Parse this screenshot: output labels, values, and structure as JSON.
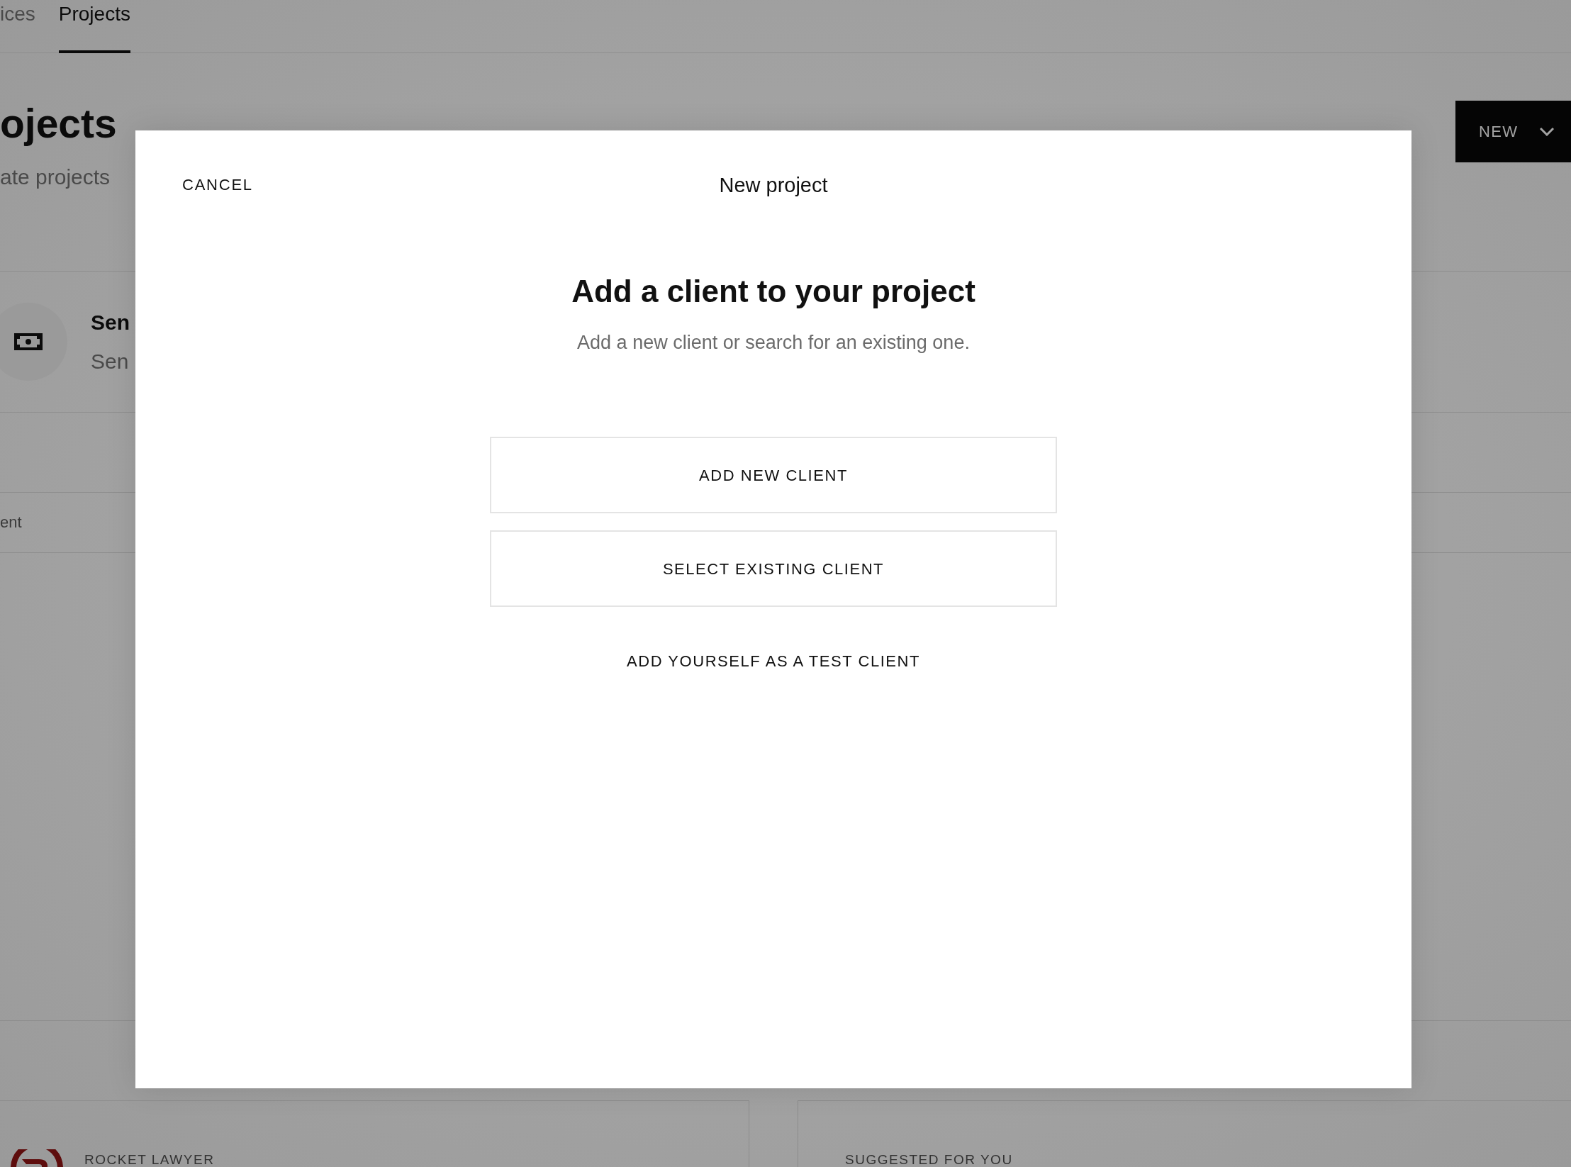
{
  "tabs": [
    {
      "label": "ices",
      "selected": false
    },
    {
      "label": "Projects",
      "selected": true
    }
  ],
  "header": {
    "title": "ojects",
    "subtitle": "ate projects",
    "new_button": {
      "label": "NEW"
    }
  },
  "feature_card": {
    "title": "Sen",
    "subtitle": "Sen"
  },
  "section_label": "ent",
  "cards": [
    {
      "kind": "logo",
      "label": "ROCKET LAWYER"
    },
    {
      "kind": "plain",
      "label": "SUGGESTED FOR YOU"
    }
  ],
  "dialog": {
    "cancel": "CANCEL",
    "title": "New project",
    "heading": "Add a client to your project",
    "subheading": "Add a new client or search for an existing one.",
    "options": [
      {
        "kind": "outlined",
        "label": "ADD NEW CLIENT"
      },
      {
        "kind": "outlined",
        "label": "SELECT EXISTING CLIENT"
      },
      {
        "kind": "text",
        "label": "ADD YOURSELF AS A TEST CLIENT"
      }
    ]
  }
}
